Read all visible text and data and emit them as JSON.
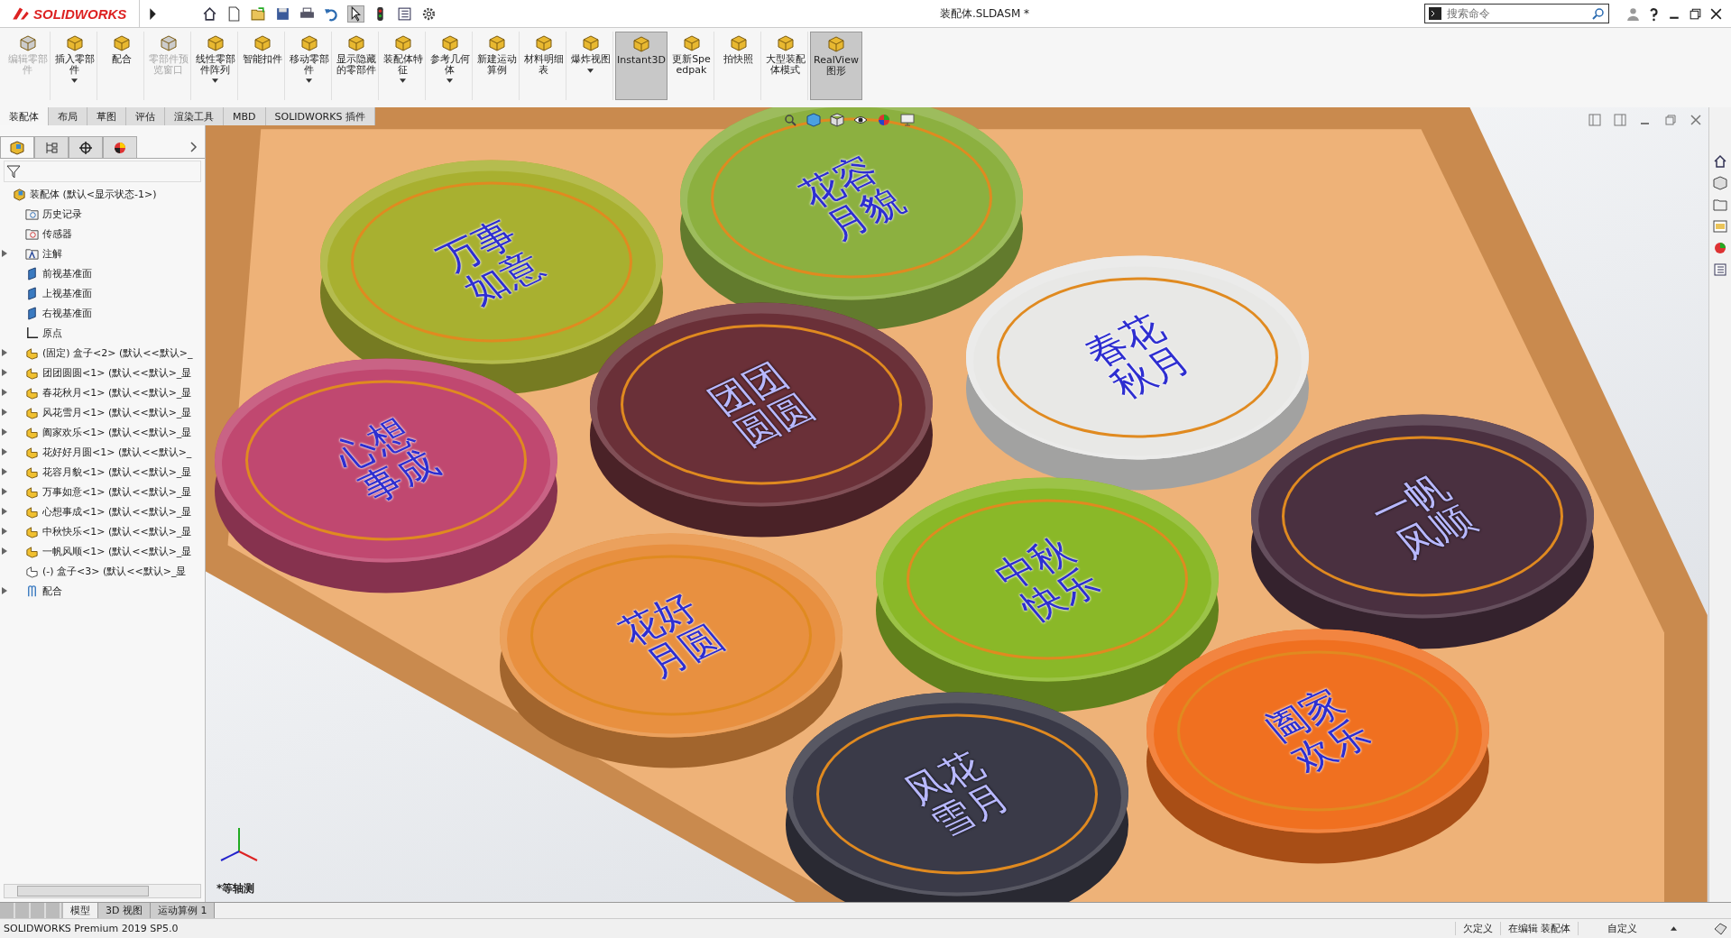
{
  "app": {
    "logo": "SOLIDWORKS"
  },
  "window": {
    "title": "装配体.SLDASM *"
  },
  "search": {
    "placeholder": "搜索命令"
  },
  "ribbon": [
    {
      "label": "编辑零部件",
      "disabled": true,
      "pressed": false,
      "dropdown": false
    },
    {
      "label": "插入零部件",
      "disabled": false,
      "pressed": false,
      "dropdown": true
    },
    {
      "label": "配合",
      "disabled": false,
      "pressed": false,
      "dropdown": false
    },
    {
      "label": "零部件预览窗口",
      "disabled": true,
      "pressed": false,
      "dropdown": false
    },
    {
      "label": "线性零部件阵列",
      "disabled": false,
      "pressed": false,
      "dropdown": true
    },
    {
      "label": "智能扣件",
      "disabled": false,
      "pressed": false,
      "dropdown": false
    },
    {
      "label": "移动零部件",
      "disabled": false,
      "pressed": false,
      "dropdown": true
    },
    {
      "label": "显示隐藏的零部件",
      "disabled": false,
      "pressed": false,
      "dropdown": false
    },
    {
      "label": "装配体特征",
      "disabled": false,
      "pressed": false,
      "dropdown": true
    },
    {
      "label": "参考几何体",
      "disabled": false,
      "pressed": false,
      "dropdown": true
    },
    {
      "label": "新建运动算例",
      "disabled": false,
      "pressed": false,
      "dropdown": false
    },
    {
      "label": "材料明细表",
      "disabled": false,
      "pressed": false,
      "dropdown": false
    },
    {
      "label": "爆炸视图",
      "disabled": false,
      "pressed": false,
      "dropdown": true
    },
    {
      "label": "Instant3D",
      "disabled": false,
      "pressed": true,
      "dropdown": false
    },
    {
      "label": "更新Speedpak",
      "disabled": false,
      "pressed": false,
      "dropdown": false
    },
    {
      "label": "拍快照",
      "disabled": false,
      "pressed": false,
      "dropdown": false
    },
    {
      "label": "大型装配体模式",
      "disabled": false,
      "pressed": false,
      "dropdown": false
    },
    {
      "label": "RealView图形",
      "disabled": false,
      "pressed": true,
      "dropdown": false
    }
  ],
  "tabs": [
    {
      "label": "装配体",
      "selected": true
    },
    {
      "label": "布局",
      "selected": false
    },
    {
      "label": "草图",
      "selected": false
    },
    {
      "label": "评估",
      "selected": false
    },
    {
      "label": "渲染工具",
      "selected": false
    },
    {
      "label": "MBD",
      "selected": false
    },
    {
      "label": "SOLIDWORKS 插件",
      "selected": false
    }
  ],
  "tree": [
    {
      "label": "装配体  (默认<显示状态-1>)",
      "kind": "assembly",
      "expandable": false,
      "children": [
        {
          "label": "历史记录",
          "kind": "history",
          "expandable": false
        },
        {
          "label": "传感器",
          "kind": "sensor",
          "expandable": false
        },
        {
          "label": "注解",
          "kind": "annotation",
          "expandable": true
        },
        {
          "label": "前视基准面",
          "kind": "plane",
          "expandable": false
        },
        {
          "label": "上视基准面",
          "kind": "plane",
          "expandable": false
        },
        {
          "label": "右视基准面",
          "kind": "plane",
          "expandable": false
        },
        {
          "label": "原点",
          "kind": "origin",
          "expandable": false
        },
        {
          "label": "(固定) 盒子<2> (默认<<默认>_",
          "kind": "part",
          "expandable": true
        },
        {
          "label": "团团圆圆<1> (默认<<默认>_显",
          "kind": "part",
          "expandable": true
        },
        {
          "label": "春花秋月<1> (默认<<默认>_显",
          "kind": "part",
          "expandable": true
        },
        {
          "label": "风花雪月<1> (默认<<默认>_显",
          "kind": "part",
          "expandable": true
        },
        {
          "label": "阖家欢乐<1> (默认<<默认>_显",
          "kind": "part",
          "expandable": true
        },
        {
          "label": "花好好月圆<1> (默认<<默认>_",
          "kind": "part",
          "expandable": true
        },
        {
          "label": "花容月貌<1> (默认<<默认>_显",
          "kind": "part",
          "expandable": true
        },
        {
          "label": "万事如意<1> (默认<<默认>_显",
          "kind": "part",
          "expandable": true
        },
        {
          "label": "心想事成<1> (默认<<默认>_显",
          "kind": "part",
          "expandable": true
        },
        {
          "label": "中秋快乐<1> (默认<<默认>_显",
          "kind": "part",
          "expandable": true
        },
        {
          "label": "一帆风顺<1> (默认<<默认>_显",
          "kind": "part",
          "expandable": true
        },
        {
          "label": "(-) 盒子<3> (默认<<默认>_显",
          "kind": "part-outline",
          "expandable": false
        },
        {
          "label": "配合",
          "kind": "mates",
          "expandable": true
        }
      ]
    }
  ],
  "viewport": {
    "view_name": "*等轴测",
    "mooncakes": [
      {
        "inscription": "花容月貌",
        "color": "#8cb040"
      },
      {
        "inscription": "万事如意",
        "color": "#a8b030"
      },
      {
        "inscription": "春花秋月",
        "color": "#e8e8e6"
      },
      {
        "inscription": "团团圆圆",
        "color": "#6a3038"
      },
      {
        "inscription": "心想事成",
        "color": "#c04870"
      },
      {
        "inscription": "一帆风顺",
        "color": "#4a3040"
      },
      {
        "inscription": "中秋快乐",
        "color": "#8ab828"
      },
      {
        "inscription": "花好月圆",
        "color": "#e89040"
      },
      {
        "inscription": "阖家欢乐",
        "color": "#f07020"
      },
      {
        "inscription": "风花雪月",
        "color": "#3a3a48"
      }
    ]
  },
  "bottom_tabs": [
    {
      "label": "模型",
      "selected": true
    },
    {
      "label": "3D 视图",
      "selected": false
    },
    {
      "label": "运动算例 1",
      "selected": false
    }
  ],
  "status_bar": {
    "version": "SOLIDWORKS Premium 2019 SP5.0",
    "definition": "欠定义",
    "editing": "在编辑 装配体",
    "units": "自定义"
  }
}
